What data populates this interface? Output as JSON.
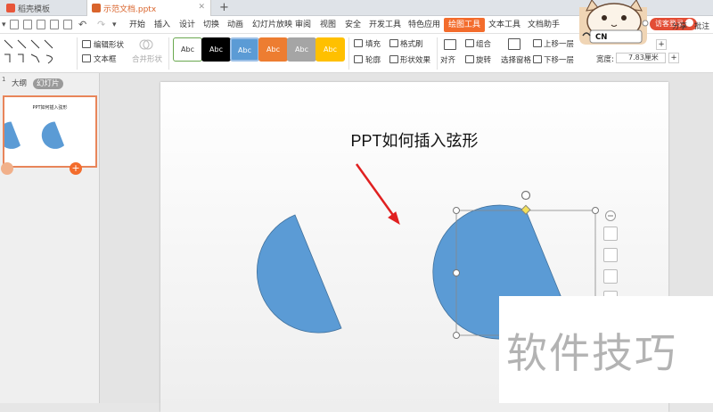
{
  "tabs": [
    {
      "label": "稻壳模板"
    },
    {
      "label": "示范文档.pptx"
    }
  ],
  "menu": {
    "items": [
      "开始",
      "插入",
      "设计",
      "切换",
      "动画",
      "幻灯片放映",
      "审阅",
      "视图",
      "安全",
      "开发工具",
      "特色应用",
      "绘图工具",
      "文本工具",
      "文档助手"
    ],
    "active": "绘图工具",
    "share": "分享",
    "comment": "批注",
    "login": "访客登录"
  },
  "ribbon": {
    "edit_shape": "编辑形状",
    "text_box": "文本框",
    "merge_shape": "合并形状",
    "style_sample": "Abc",
    "fill": "填充",
    "format_painter": "格式刷",
    "outline": "轮廓",
    "shape_effect": "形状效果",
    "align": "对齐",
    "group": "组合",
    "rotate": "旋转",
    "selection_pane": "选择窗格",
    "bring_forward": "上移一层",
    "send_backward": "下移一层",
    "width_label": "宽度:",
    "width_value": "7.83厘米",
    "badge": "CN"
  },
  "panel": {
    "outline_tab": "大纲",
    "slides_tab": "幻灯片",
    "slide_number": "1",
    "thumb_title": "PPT如何插入弦形"
  },
  "slide": {
    "title": "PPT如何插入弦形"
  },
  "watermark": "软件技巧",
  "colors": {
    "shape_fill": "#5b9bd5",
    "shape_stroke": "#41719c",
    "accent": "#f36c2c",
    "arrow": "#e02020"
  },
  "icons": [
    "save-icon",
    "print-icon",
    "undo-icon",
    "redo-icon",
    "layers-icon",
    "pen-icon",
    "fill-icon",
    "play-icon",
    "add-slide-icon",
    "user-icon"
  ]
}
